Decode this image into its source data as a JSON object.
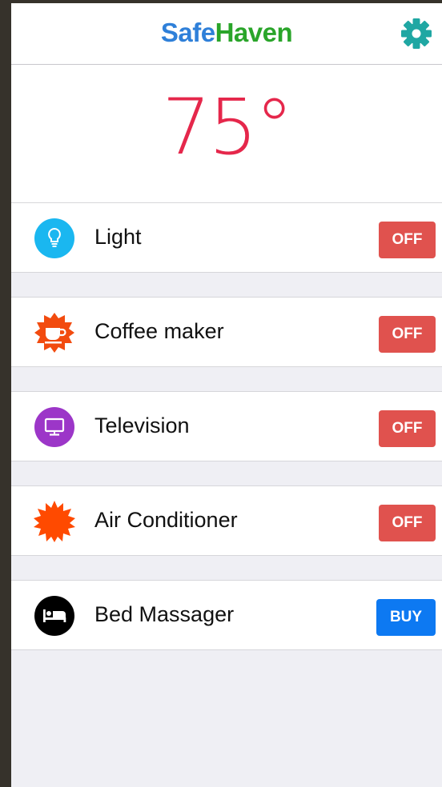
{
  "header": {
    "brand_part1": "Safe",
    "brand_part2": "Haven",
    "settings_icon": "gear-icon"
  },
  "thermostat": {
    "value": "75",
    "unit": "°",
    "color": "#e5274b"
  },
  "devices": [
    {
      "label": "Light",
      "icon": "lightbulb-icon",
      "icon_color": "#1ab7f0",
      "action": "OFF",
      "action_color": "#e0524e"
    },
    {
      "label": "Coffee maker",
      "icon": "coffee-cup-icon",
      "icon_color": "#f24b0f",
      "action": "OFF",
      "action_color": "#e0524e"
    },
    {
      "label": "Television",
      "icon": "television-icon",
      "icon_color": "#9c36c8",
      "action": "OFF",
      "action_color": "#e0524e"
    },
    {
      "label": "Air Conditioner",
      "icon": "sun-burst-icon",
      "icon_color": "#ff4a00",
      "action": "OFF",
      "action_color": "#e0524e"
    },
    {
      "label": "Bed Massager",
      "icon": "bed-icon",
      "icon_color": "#000000",
      "action": "BUY",
      "action_color": "#0d79f2"
    }
  ],
  "colors": {
    "brand_blue": "#2f80d9",
    "brand_green": "#2aa52a",
    "gear": "#1fa7a3",
    "background": "#efeff4"
  }
}
